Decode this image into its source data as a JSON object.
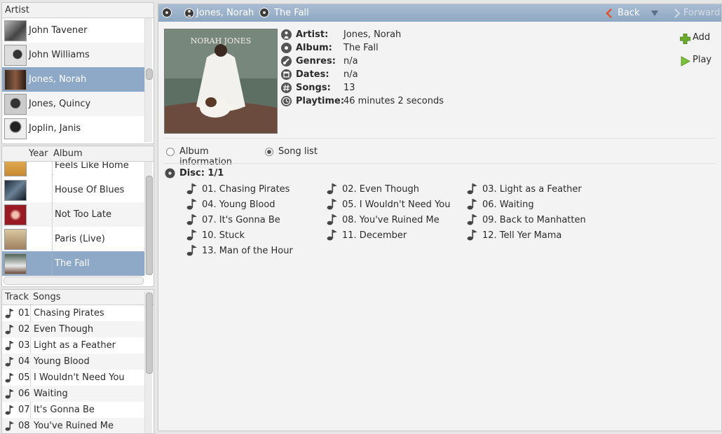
{
  "artist_pane": {
    "header": "Artist",
    "items": [
      {
        "label": "John Tavener",
        "selected": false
      },
      {
        "label": "John Williams",
        "selected": false
      },
      {
        "label": "Jones, Norah",
        "selected": true
      },
      {
        "label": "Jones, Quincy",
        "selected": false
      },
      {
        "label": "Joplin, Janis",
        "selected": false
      }
    ]
  },
  "album_pane": {
    "headers": {
      "year": "Year",
      "album": "Album"
    },
    "items": [
      {
        "label": "Feels Like Home"
      },
      {
        "label": "House Of Blues"
      },
      {
        "label": "Not Too Late"
      },
      {
        "label": "Paris (Live)"
      },
      {
        "label": "The Fall",
        "selected": true
      }
    ]
  },
  "songs_pane": {
    "headers": {
      "track": "Track",
      "songs": "Songs"
    },
    "items": [
      {
        "track": "01",
        "title": "Chasing Pirates"
      },
      {
        "track": "02",
        "title": "Even Though"
      },
      {
        "track": "03",
        "title": "Light as a Feather"
      },
      {
        "track": "04",
        "title": "Young Blood"
      },
      {
        "track": "05",
        "title": "I Wouldn't Need You"
      },
      {
        "track": "06",
        "title": "Waiting"
      },
      {
        "track": "07",
        "title": "It's Gonna Be"
      },
      {
        "track": "08",
        "title": "You've Ruined Me"
      }
    ]
  },
  "toolbar": {
    "crumb_artist": "Jones, Norah",
    "crumb_album": "The Fall",
    "back": "Back",
    "forward": "Forward"
  },
  "info": {
    "rows": [
      {
        "key": "Artist:",
        "value": "Jones, Norah"
      },
      {
        "key": "Album:",
        "value": "The Fall"
      },
      {
        "key": "Genres:",
        "value": "n/a"
      },
      {
        "key": "Dates:",
        "value": "n/a"
      },
      {
        "key": "Songs:",
        "value": "13"
      },
      {
        "key": "Playtime:",
        "value": "46 minutes 2 seconds"
      }
    ],
    "add": "Add",
    "play": "Play",
    "cover_text": "NORAH JONES"
  },
  "view": {
    "album_information": "Album information",
    "song_list": "Song list",
    "selected": "song_list"
  },
  "disc": {
    "label": "Disc: 1/1",
    "songs": [
      "01. Chasing Pirates",
      "02. Even Though",
      "03. Light as a Feather",
      "04. Young Blood",
      "05. I Wouldn't Need You",
      "06. Waiting",
      "07. It's Gonna Be",
      "08. You've Ruined Me",
      "09. Back to Manhatten",
      "10. Stuck",
      "11. December",
      "12. Tell Yer Mama",
      "13. Man of the Hour"
    ]
  },
  "colors": {
    "selection": "#8ea9c7",
    "toolbar": "#9bb1ca",
    "add_icon": "#6cab2c",
    "play_icon": "#7cc13b"
  }
}
